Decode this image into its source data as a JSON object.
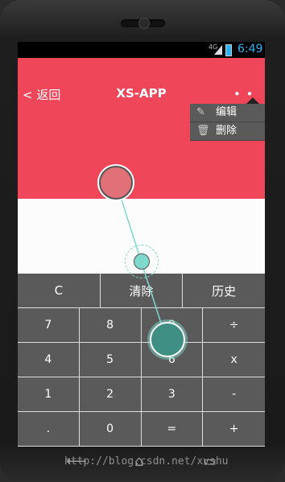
{
  "status": {
    "network": "4G",
    "time": "6:49"
  },
  "app": {
    "back_label": "< 返回",
    "title": "XS-APP",
    "overflow_label": "⋮"
  },
  "menu": {
    "items": [
      {
        "label": "编辑",
        "icon": "edit-icon"
      },
      {
        "label": "删除",
        "icon": "trash-icon"
      }
    ]
  },
  "keypad": {
    "row1": [
      "C",
      "清除",
      "历史"
    ],
    "rows": [
      [
        "7",
        "8",
        "9",
        "÷"
      ],
      [
        "4",
        "5",
        "6",
        "x"
      ],
      [
        "1",
        "2",
        "3",
        "-"
      ],
      [
        ".",
        "0",
        "=",
        "+"
      ]
    ]
  },
  "colors": {
    "accent": "#ef465a",
    "keypad": "#5a5a5a",
    "teal": "#7fd8cc"
  },
  "watermark": "http://blog.csdn.net/xvshu"
}
